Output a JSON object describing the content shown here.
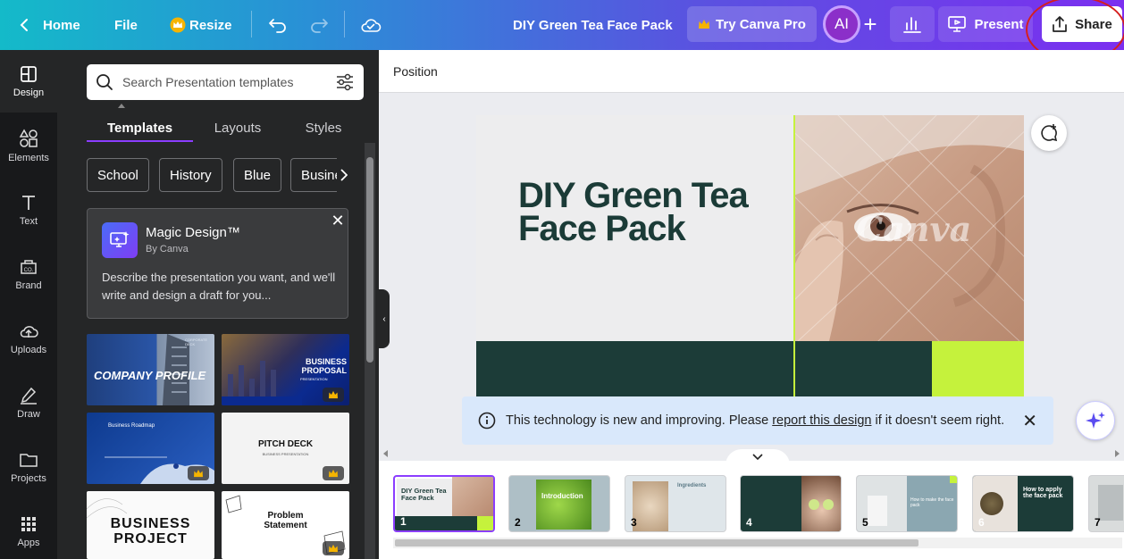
{
  "topbar": {
    "home_label": "Home",
    "file_label": "File",
    "resize_label": "Resize",
    "doc_title": "DIY Green Tea Face Pack",
    "try_pro_label": "Try Canva Pro",
    "avatar_initials": "AI",
    "present_label": "Present",
    "share_label": "Share"
  },
  "leftnav": {
    "items": [
      {
        "label": "Design",
        "icon": "layout-icon"
      },
      {
        "label": "Elements",
        "icon": "shapes-icon"
      },
      {
        "label": "Text",
        "icon": "text-icon"
      },
      {
        "label": "Brand",
        "icon": "brand-icon"
      },
      {
        "label": "Uploads",
        "icon": "upload-cloud-icon"
      },
      {
        "label": "Draw",
        "icon": "pen-icon"
      },
      {
        "label": "Projects",
        "icon": "folder-icon"
      },
      {
        "label": "Apps",
        "icon": "grid-icon"
      }
    ]
  },
  "panel": {
    "search_placeholder": "Search Presentation templates",
    "tabs": [
      "Templates",
      "Layouts",
      "Styles"
    ],
    "chips": [
      "School",
      "History",
      "Blue",
      "Busine"
    ],
    "magic": {
      "title": "Magic Design™",
      "subtitle": "By Canva",
      "description": "Describe the presentation you want, and we'll write and design a draft for you..."
    },
    "templates": [
      {
        "title": "COMPANY PROFILE",
        "subtitle": "CORPORATE DECK",
        "pro": false
      },
      {
        "title": "BUSINESS PROPOSAL",
        "subtitle": "PRESENTATION",
        "pro": true
      },
      {
        "title": "Business Roadmap",
        "subtitle": "",
        "pro": true
      },
      {
        "title": "PITCH DECK",
        "subtitle": "BUSINESS PRESENTATION",
        "pro": true
      },
      {
        "title": "BUSINESS PROJECT",
        "subtitle": "",
        "pro": false
      },
      {
        "title": "Problem Statement",
        "subtitle": "",
        "pro": true
      }
    ]
  },
  "editor": {
    "position_label": "Position",
    "slide_title": "DIY Green Tea Face Pack",
    "watermark": "Canva",
    "notice_before": "This technology is new and improving. Please",
    "notice_link": "report this design",
    "notice_after": "if it doesn't seem right."
  },
  "filmstrip": [
    {
      "num": "1",
      "caption": "DIY Green Tea Face Pack"
    },
    {
      "num": "2",
      "caption": "Introduction"
    },
    {
      "num": "3",
      "caption": "Ingredients"
    },
    {
      "num": "4",
      "caption": ""
    },
    {
      "num": "5",
      "caption": "How to make the face pack"
    },
    {
      "num": "6",
      "caption": "How to apply the face pack"
    },
    {
      "num": "7",
      "caption": ""
    }
  ],
  "colors": {
    "accent_purple": "#8b3dff",
    "slide_dark_green": "#1c3c38",
    "slide_lime": "#c5f23c",
    "annotation_red": "#d51f1f"
  }
}
